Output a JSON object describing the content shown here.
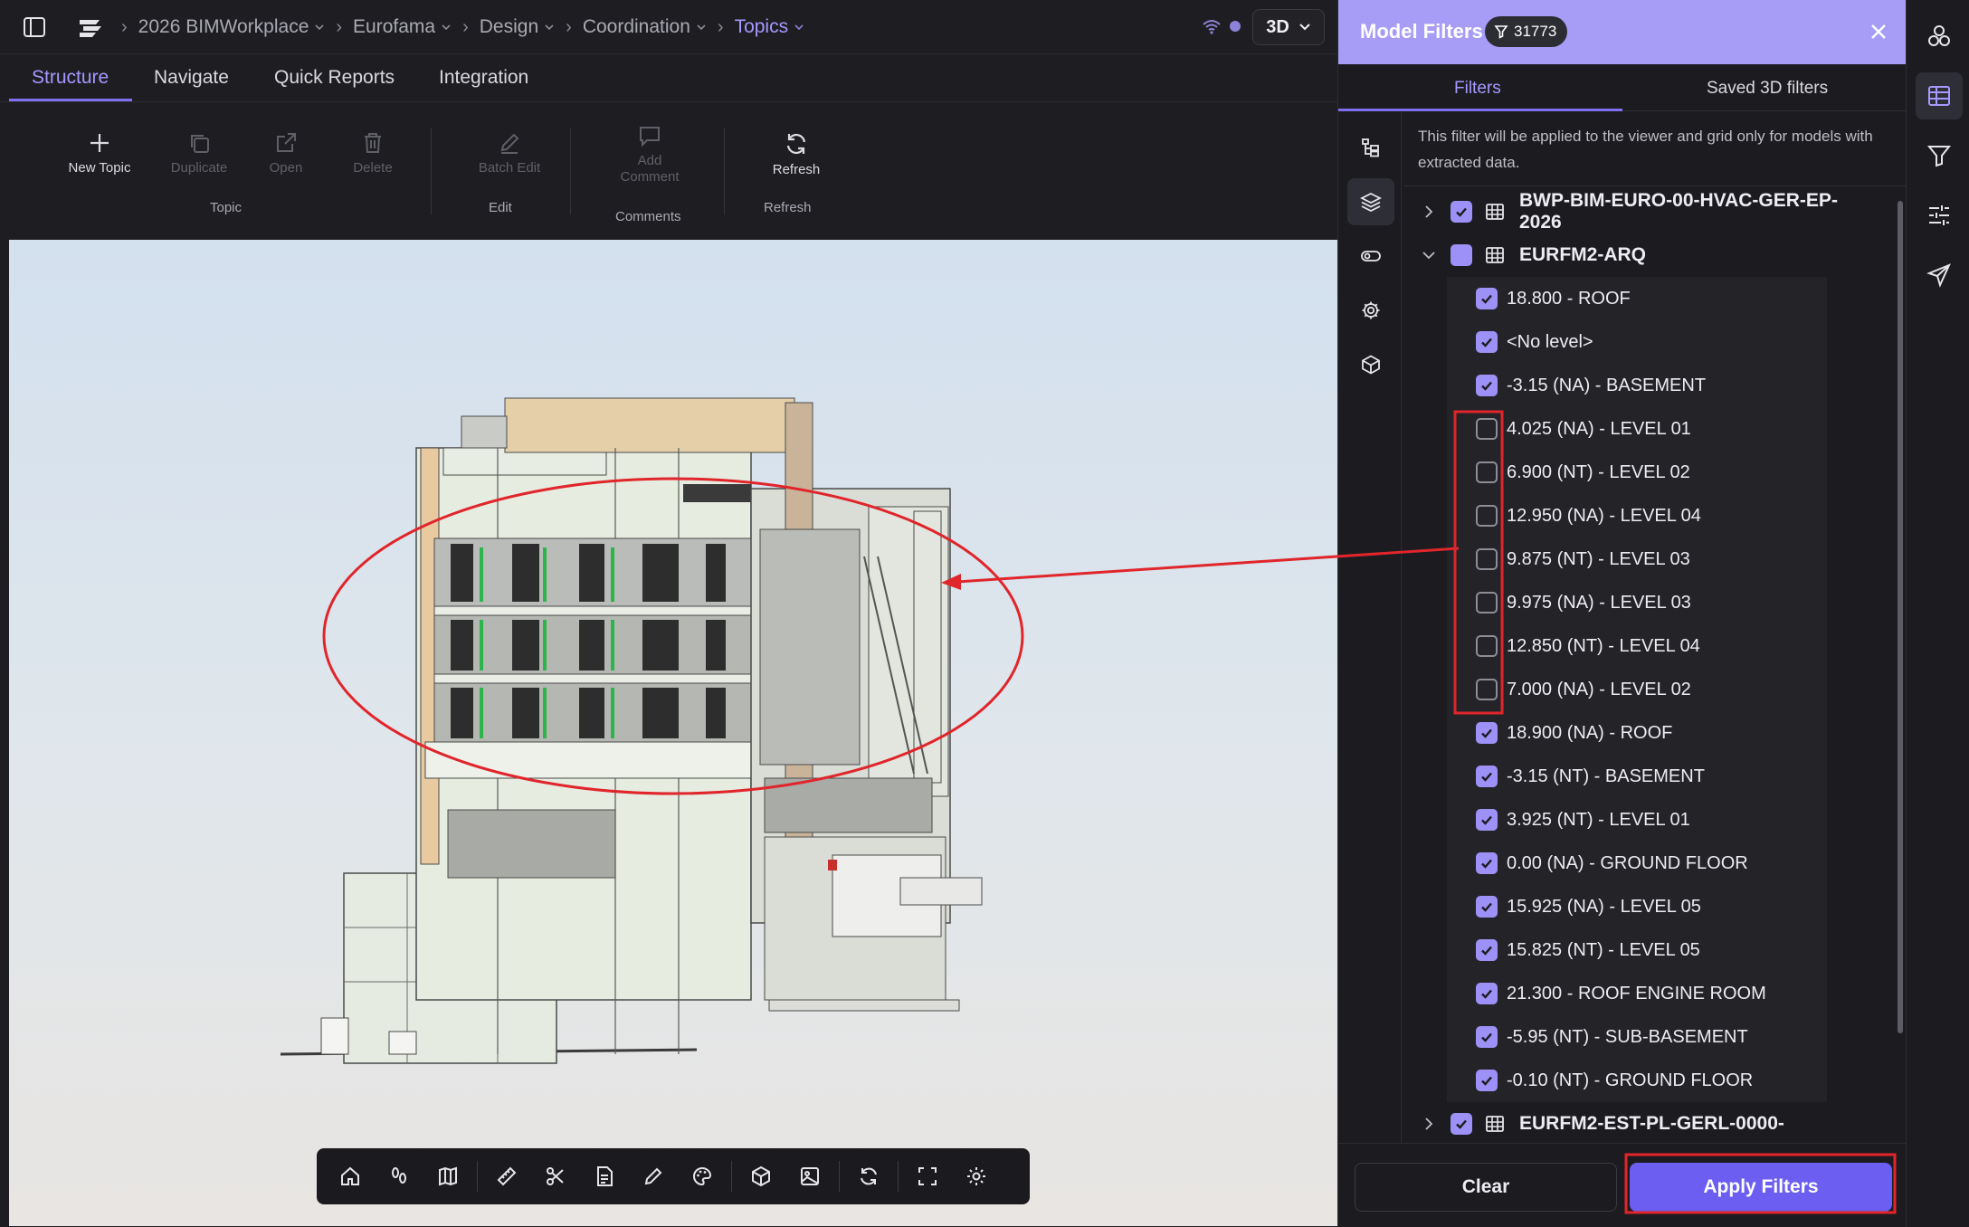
{
  "breadcrumb": {
    "items": [
      "2026 BIMWorkplace",
      "Eurofama",
      "Design",
      "Coordination",
      "Topics"
    ]
  },
  "view_mode": "3D",
  "main_tabs": [
    "Structure",
    "Navigate",
    "Quick Reports",
    "Integration"
  ],
  "ribbon": {
    "new_topic": "New Topic",
    "duplicate": "Duplicate",
    "open": "Open",
    "delete": "Delete",
    "group_topic": "Topic",
    "batch_edit": "Batch Edit",
    "group_edit": "Edit",
    "add_comment_line1": "Add",
    "add_comment_line2": "Comment",
    "group_comments": "Comments",
    "refresh": "Refresh",
    "group_refresh": "Refresh"
  },
  "panel": {
    "title": "Model Filters",
    "filter_count": "31773",
    "tab_filters": "Filters",
    "tab_saved": "Saved 3D filters",
    "note": "This filter will be applied to the viewer and grid only for models with extracted data.",
    "clear_label": "Clear",
    "apply_label": "Apply Filters"
  },
  "models": [
    {
      "name": "BWP-BIM-EURO-00-HVAC-GER-EP-2026",
      "checked": "on",
      "expanded": false
    },
    {
      "name": "EURFM2-ARQ",
      "checked": "partial",
      "expanded": true
    },
    {
      "name": "EURFM2-EST-PL-GERL-0000-",
      "checked": "on",
      "expanded": false
    }
  ],
  "levels": [
    {
      "label": "18.800 - ROOF",
      "checked": true
    },
    {
      "label": "<No level>",
      "checked": true
    },
    {
      "label": "-3.15 (NA) - BASEMENT",
      "checked": true
    },
    {
      "label": "4.025 (NA) - LEVEL 01",
      "checked": false
    },
    {
      "label": "6.900 (NT) - LEVEL 02",
      "checked": false
    },
    {
      "label": "12.950 (NA) - LEVEL 04",
      "checked": false
    },
    {
      "label": "9.875 (NT) - LEVEL 03",
      "checked": false
    },
    {
      "label": "9.975 (NA) - LEVEL 03",
      "checked": false
    },
    {
      "label": "12.850 (NT) - LEVEL 04",
      "checked": false
    },
    {
      "label": "7.000 (NA) - LEVEL 02",
      "checked": false
    },
    {
      "label": "18.900 (NA) - ROOF",
      "checked": true
    },
    {
      "label": "-3.15 (NT) - BASEMENT",
      "checked": true
    },
    {
      "label": "3.925 (NT) - LEVEL 01",
      "checked": true
    },
    {
      "label": "0.00 (NA) - GROUND FLOOR",
      "checked": true
    },
    {
      "label": "15.925 (NA) - LEVEL 05",
      "checked": true
    },
    {
      "label": "15.825 (NT) - LEVEL 05",
      "checked": true
    },
    {
      "label": "21.300 - ROOF ENGINE ROOM",
      "checked": true
    },
    {
      "label": "-5.95 (NT) - SUB-BASEMENT",
      "checked": true
    },
    {
      "label": "-0.10 (NT) - GROUND FLOOR",
      "checked": true
    }
  ],
  "icons": {
    "viewer_toolbar": [
      "home-icon",
      "walk-icon",
      "map-icon",
      "measure-icon",
      "section-cut-icon",
      "document-icon",
      "markup-pen-icon",
      "palette-icon",
      "cube-icon",
      "image-icon",
      "refresh-icon",
      "fullscreen-icon",
      "settings-icon"
    ],
    "panel_rail": [
      "tree-icon",
      "layers-icon",
      "toggle-icon",
      "gear-icon",
      "box-icon"
    ],
    "far_sidebar": [
      "models-icon",
      "table-icon",
      "filter-icon",
      "sliders-icon",
      "send-icon"
    ]
  },
  "colors": {
    "accent": "#7f70f2",
    "panel_header": "#a79cf6",
    "apply_button": "#6b5ef0",
    "annotation": "#e0252b"
  }
}
